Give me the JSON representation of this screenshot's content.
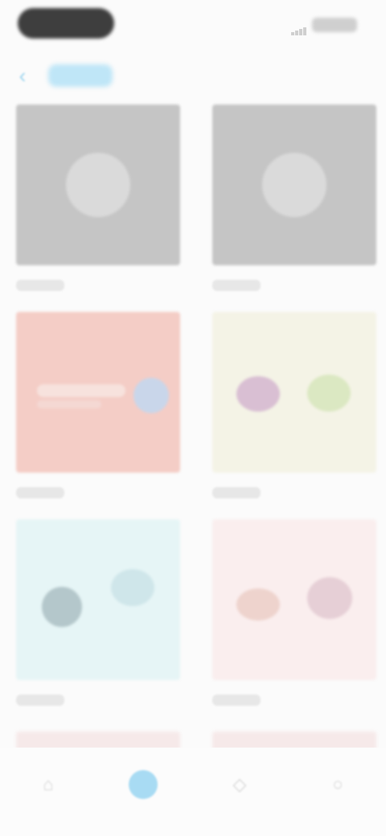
{
  "header": {
    "back_icon": "chevron-left-icon",
    "title": ""
  },
  "grid": {
    "items": [
      {
        "type": "placeholder",
        "caption": ""
      },
      {
        "type": "placeholder",
        "caption": ""
      },
      {
        "type": "image-pink",
        "caption": ""
      },
      {
        "type": "image-cream",
        "caption": ""
      },
      {
        "type": "image-cyan",
        "caption": ""
      },
      {
        "type": "image-blush",
        "caption": ""
      }
    ]
  },
  "bottom_nav": {
    "items": [
      {
        "icon": "home-icon",
        "active": false
      },
      {
        "icon": "gallery-icon",
        "active": true
      },
      {
        "icon": "explore-icon",
        "active": false
      },
      {
        "icon": "profile-icon",
        "active": false
      }
    ]
  },
  "colors": {
    "accent": "#a8dbf3",
    "placeholder": "#c5c5c5",
    "pink": "#f4cdc6",
    "cream": "#f4f3e6",
    "cyan": "#e6f5f6",
    "blush": "#faeeee"
  }
}
